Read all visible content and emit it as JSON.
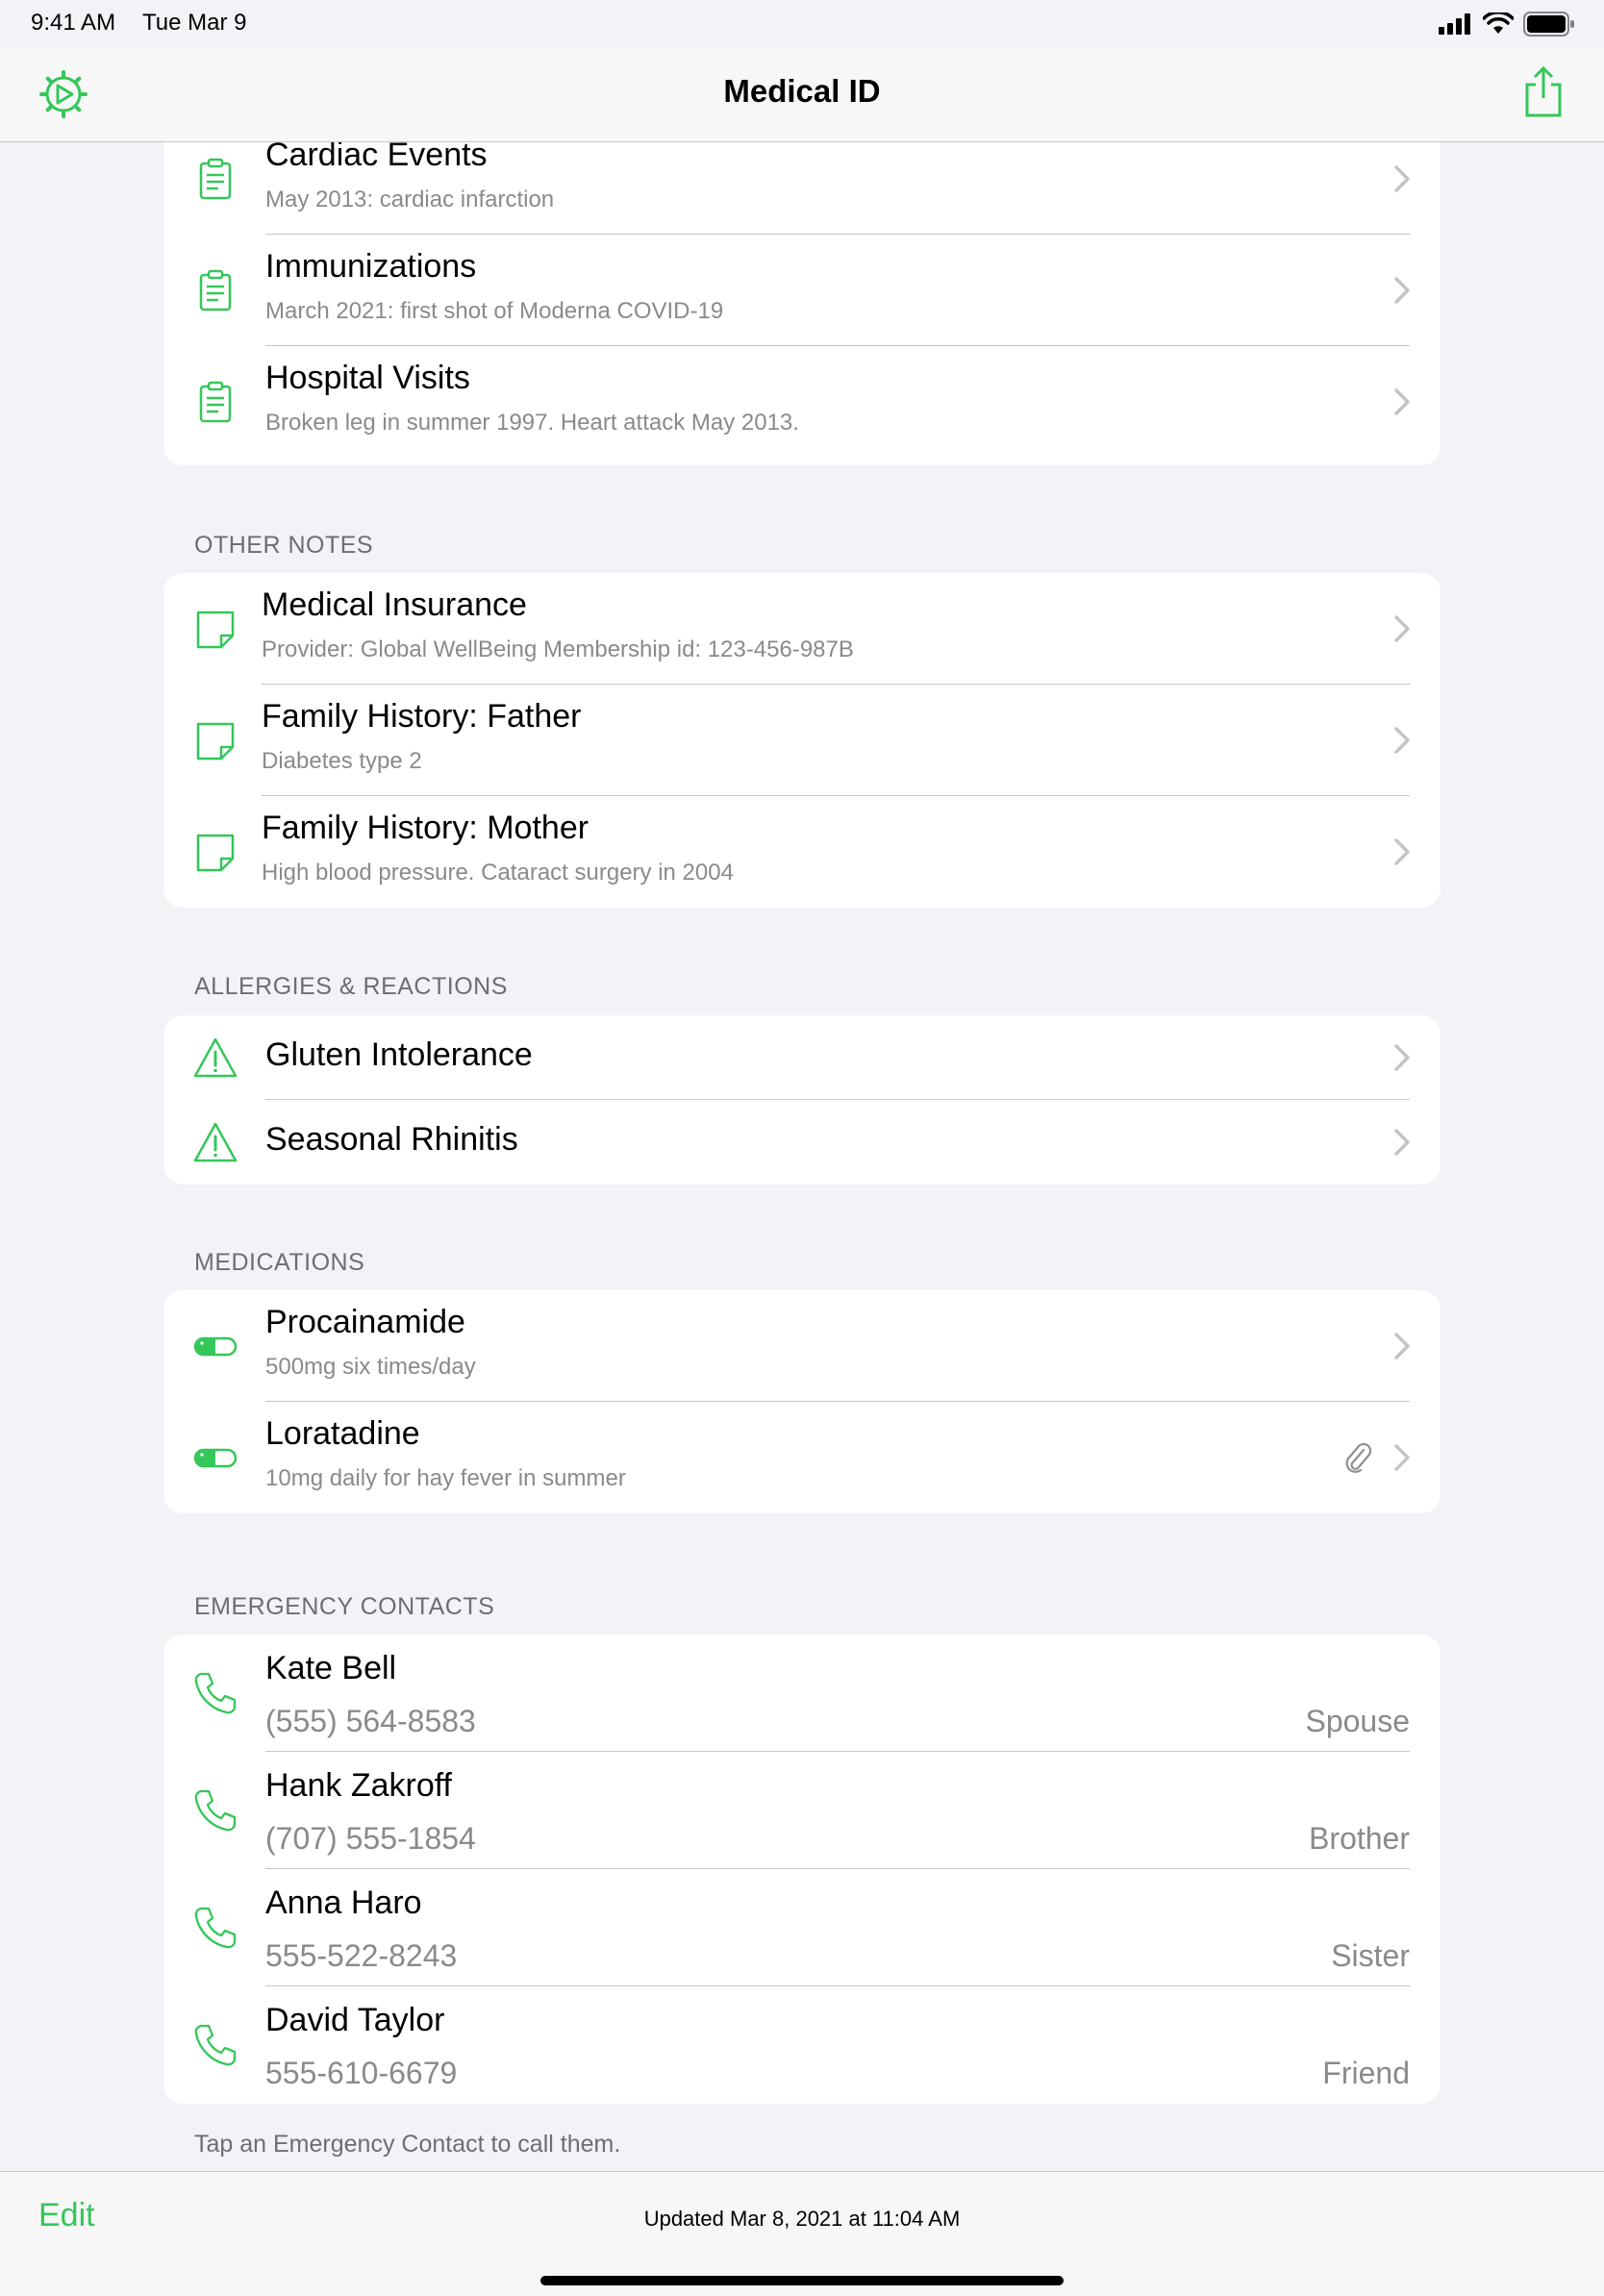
{
  "status_bar": {
    "time": "9:41 AM",
    "date": "Tue Mar 9"
  },
  "nav": {
    "title": "Medical ID",
    "left_icon": "medical-id-gear-icon",
    "right_icon": "share-icon"
  },
  "colors": {
    "accent": "#34c759",
    "secondary_text": "#8a8a8e",
    "background": "#f2f2f7"
  },
  "records": [
    {
      "title": "Cardiac Events",
      "subtitle": "May 2013: cardiac infarction",
      "icon": "clipboard-icon"
    },
    {
      "title": "Immunizations",
      "subtitle": "March 2021: first shot of Moderna COVID-19",
      "icon": "clipboard-icon"
    },
    {
      "title": "Hospital Visits",
      "subtitle": "Broken leg in summer 1997. Heart attack May 2013.",
      "icon": "clipboard-icon"
    }
  ],
  "other_notes": {
    "header": "OTHER NOTES",
    "items": [
      {
        "title": "Medical Insurance",
        "subtitle": "Provider: Global WellBeing Membership id: 123-456-987B",
        "icon": "note-icon"
      },
      {
        "title": "Family History: Father",
        "subtitle": "Diabetes type 2",
        "icon": "note-icon"
      },
      {
        "title": "Family History: Mother",
        "subtitle": "High blood pressure. Cataract surgery in 2004",
        "icon": "note-icon"
      }
    ]
  },
  "allergies": {
    "header": "ALLERGIES & REACTIONS",
    "items": [
      {
        "title": "Gluten Intolerance",
        "icon": "warning-icon"
      },
      {
        "title": "Seasonal Rhinitis",
        "icon": "warning-icon"
      }
    ]
  },
  "medications": {
    "header": "MEDICATIONS",
    "items": [
      {
        "title": "Procainamide",
        "subtitle": "500mg six times/day",
        "icon": "pill-icon"
      },
      {
        "title": "Loratadine",
        "subtitle": "10mg daily for hay fever in summer",
        "icon": "pill-icon",
        "attachment_icon": "paperclip-icon"
      }
    ]
  },
  "contacts": {
    "header": "EMERGENCY CONTACTS",
    "items": [
      {
        "name": "Kate Bell",
        "phone": "(555) 564-8583",
        "relation": "Spouse",
        "icon": "phone-icon"
      },
      {
        "name": "Hank Zakroff",
        "phone": "(707) 555-1854",
        "relation": "Brother",
        "icon": "phone-icon"
      },
      {
        "name": "Anna Haro",
        "phone": "555-522-8243",
        "relation": "Sister",
        "icon": "phone-icon"
      },
      {
        "name": "David Taylor",
        "phone": "555-610-6679",
        "relation": "Friend",
        "icon": "phone-icon"
      }
    ],
    "footer": "Tap an Emergency Contact to call them."
  },
  "bottom_bar": {
    "edit_label": "Edit",
    "updated_text": "Updated Mar 8, 2021 at 11:04 AM"
  }
}
